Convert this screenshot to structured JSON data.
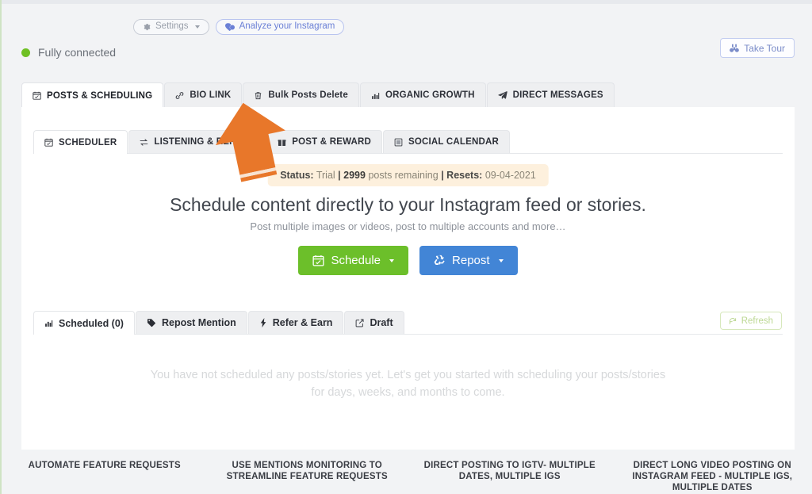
{
  "topbar": {
    "settings_label": "Settings",
    "settings_icon": "gear-icon",
    "analyze_label": "Analyze your Instagram",
    "analyze_icon": "heart-badge-icon",
    "take_tour_label": "Take Tour",
    "take_tour_icon": "binoculars-icon"
  },
  "connection": {
    "status_label": "Fully connected",
    "dot_color": "#6fc024"
  },
  "main_tabs": [
    {
      "label": "POSTS & SCHEDULING",
      "icon": "calendar-icon",
      "active": true
    },
    {
      "label": "BIO LINK",
      "icon": "link-icon",
      "active": false
    },
    {
      "label": "Bulk Posts Delete",
      "icon": "trash-icon",
      "active": false
    },
    {
      "label": "ORGANIC GROWTH",
      "icon": "bar-chart-icon",
      "active": false
    },
    {
      "label": "DIRECT MESSAGES",
      "icon": "paper-plane-icon",
      "active": false
    }
  ],
  "sub_tabs": [
    {
      "label": "SCHEDULER",
      "icon": "calendar-icon",
      "active": true
    },
    {
      "label": "LISTENING & REPOST",
      "icon": "exchange-icon",
      "active": false
    },
    {
      "label": "POST & REWARD",
      "icon": "gift-icon",
      "active": false
    },
    {
      "label": "SOCIAL CALENDAR",
      "icon": "calendar-grid-icon",
      "active": false
    }
  ],
  "status_banner": {
    "status_key": "Status:",
    "status_value": "Trial",
    "sep1": "|",
    "posts_count": "2999",
    "posts_text": "posts remaining",
    "sep2": "|",
    "resets_key": "Resets:",
    "resets_value": "09-04-2021",
    "background": "#fdf0dd"
  },
  "hero": {
    "headline": "Schedule content directly to your Instagram feed or stories.",
    "subhead": "Post multiple images or videos, post to multiple accounts and more…",
    "schedule_button": "Schedule",
    "schedule_icon": "calendar-icon",
    "schedule_color": "#6cbf2a",
    "repost_button": "Repost",
    "repost_icon": "recycle-icon",
    "repost_color": "#4285d6"
  },
  "lower_tabs": [
    {
      "label": "Scheduled (0)",
      "icon": "bar-chart-icon",
      "active": true
    },
    {
      "label": "Repost Mention",
      "icon": "tag-icon",
      "active": false
    },
    {
      "label": "Refer & Earn",
      "icon": "bolt-icon",
      "active": false
    },
    {
      "label": "Draft",
      "icon": "edit-square-icon",
      "active": false
    }
  ],
  "refresh": {
    "label": "Refresh",
    "icon": "refresh-icon"
  },
  "empty_state": {
    "message": "You have not scheduled any posts/stories yet. Let's get you started with scheduling your posts/stories for days, weeks, and months to come."
  },
  "features": [
    {
      "title": "AUTOMATE FEATURE REQUESTS"
    },
    {
      "title": "USE MENTIONS MONITORING TO STREAMLINE FEATURE REQUESTS"
    },
    {
      "title": "DIRECT POSTING TO IGTV- MULTIPLE DATES, MULTIPLE IGS"
    },
    {
      "title": "DIRECT LONG VIDEO POSTING ON INSTAGRAM FEED - MULTIPLE IGS, MULTIPLE DATES"
    }
  ],
  "annotation": {
    "arrow_color": "#e8772a",
    "arrow_points_to": "Bulk Posts Delete"
  }
}
